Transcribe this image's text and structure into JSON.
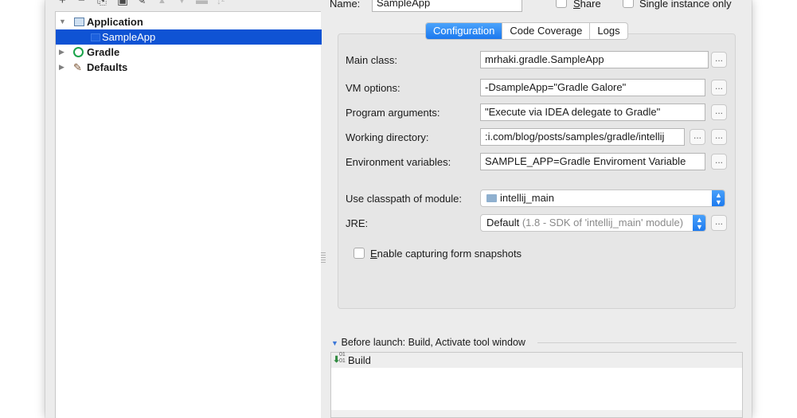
{
  "toolbar": {
    "add": "+",
    "remove": "−",
    "copy": "⎘",
    "save": "▣",
    "edit": "✎",
    "up": "▲",
    "down": "▼",
    "folder": "▬",
    "sort": "↓ᶻ"
  },
  "tree": {
    "items": [
      {
        "label": "Application",
        "expanded": true
      },
      {
        "label": "SampleApp",
        "selected": true
      },
      {
        "label": "Gradle",
        "expanded": false
      },
      {
        "label": "Defaults",
        "expanded": false
      }
    ]
  },
  "name_row": {
    "label": "Name:",
    "value": "SampleApp",
    "share_label": "Share",
    "single_instance_label": "Single instance only"
  },
  "tabs": [
    {
      "label": "Configuration",
      "active": true
    },
    {
      "label": "Code Coverage",
      "active": false
    },
    {
      "label": "Logs",
      "active": false
    }
  ],
  "config": {
    "main_class_label": "Main class:",
    "main_class_value": "mrhaki.gradle.SampleApp",
    "vm_options_label": "VM options:",
    "vm_options_value": "-DsampleApp=\"Gradle Galore\"",
    "program_args_label": "Program arguments:",
    "program_args_value": "\"Execute via IDEA delegate to Gradle\"",
    "working_dir_label": "Working directory:",
    "working_dir_value": ":i.com/blog/posts/samples/gradle/intellij",
    "env_vars_label": "Environment variables:",
    "env_vars_value": "SAMPLE_APP=Gradle Enviroment Variable",
    "classpath_label": "Use classpath of module:",
    "classpath_value": "intellij_main",
    "jre_label": "JRE:",
    "jre_value": "Default",
    "jre_detail": "(1.8 - SDK of 'intellij_main' module)",
    "snapshots_label": "Enable capturing form snapshots",
    "dots": "..."
  },
  "before_launch": {
    "title": "Before launch: Build, Activate tool window",
    "items": [
      {
        "label": "Build",
        "icon": "build-icon"
      }
    ]
  },
  "colors": {
    "selection": "#0f53d4",
    "tab_active": "#1b78ee",
    "window_bg": "#ececec"
  }
}
